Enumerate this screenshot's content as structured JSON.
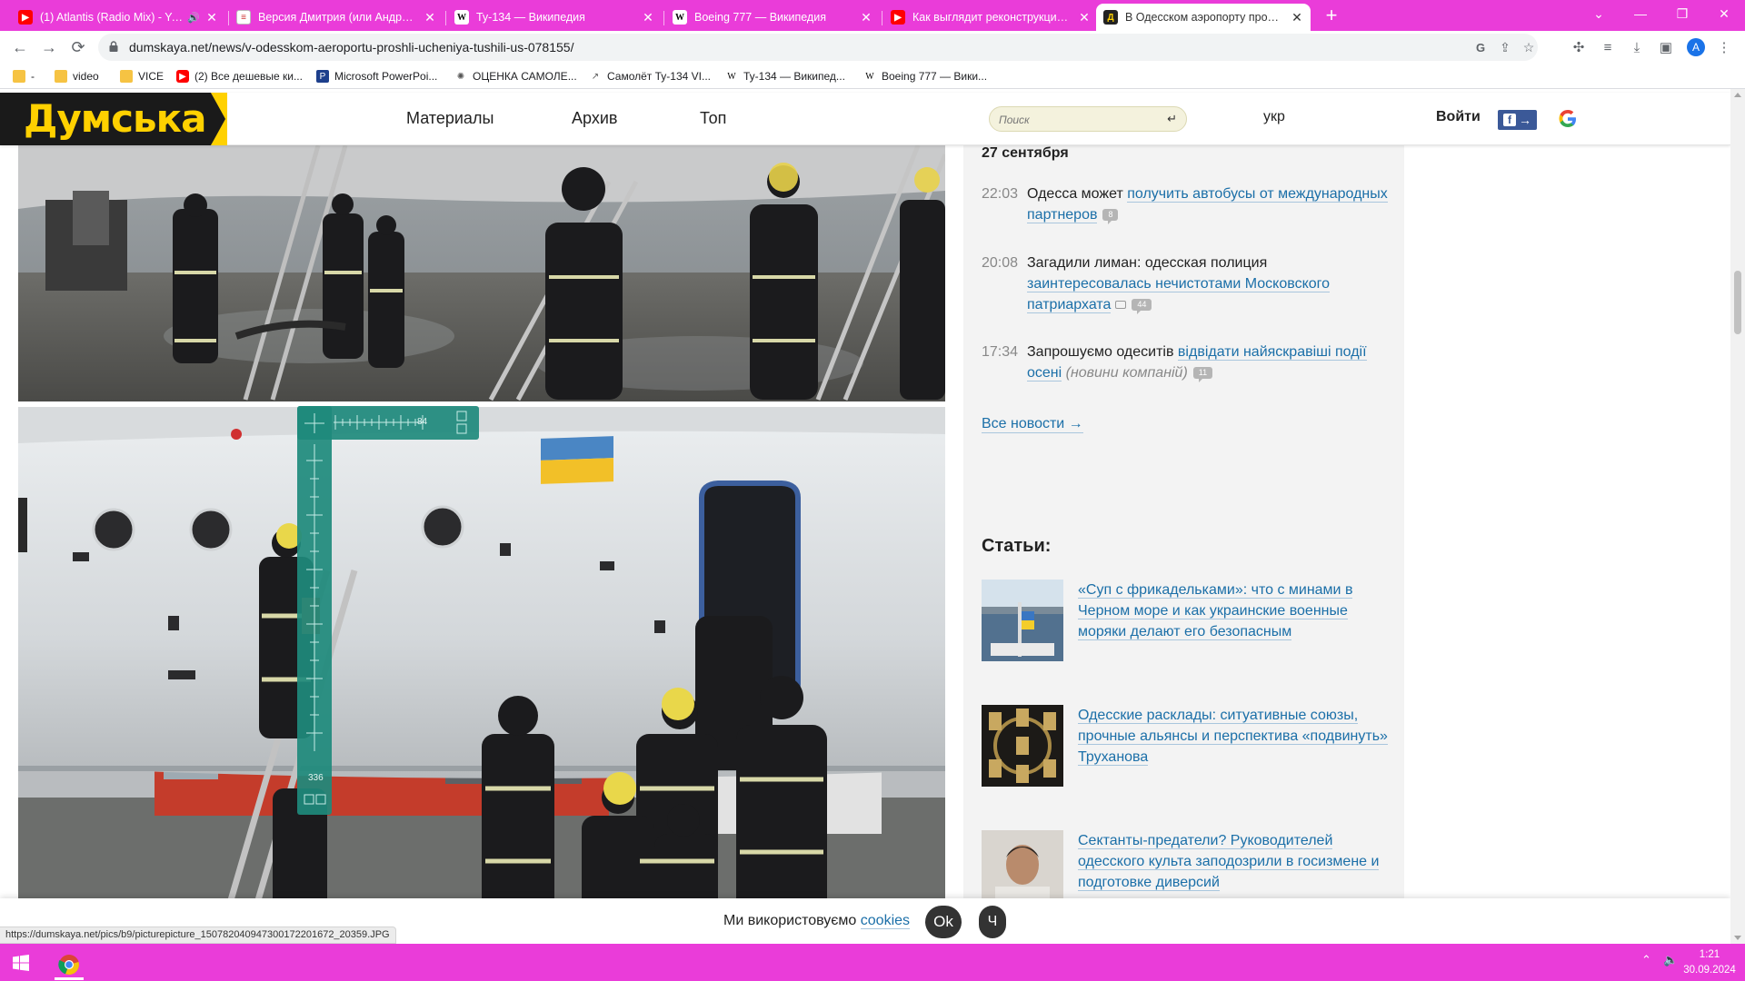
{
  "tabs": [
    {
      "title": "(1) Atlantis (Radio Mix) - YouTube",
      "icon": "youtube-icon",
      "audio": true
    },
    {
      "title": "Версия Дмитрия (или Андрея) Ф",
      "icon": "document-icon"
    },
    {
      "title": "Ту-134 — Википедия",
      "icon": "wikipedia-icon"
    },
    {
      "title": "Boeing 777 — Википедия",
      "icon": "wikipedia-icon"
    },
    {
      "title": "Как выглядит реконструкция сб",
      "icon": "youtube-icon"
    },
    {
      "title": "В Одесском аэропорту прошли",
      "icon": "dumskaya-icon",
      "active": true
    }
  ],
  "address": {
    "url": "dumskaya.net/news/v-odesskom-aeroportu-proshli-ucheniya-tushili-us-078155/"
  },
  "profile_initial": "A",
  "bookmarks": [
    {
      "label": "-",
      "icon": "folder-icon"
    },
    {
      "label": "video",
      "icon": "folder-icon"
    },
    {
      "label": "VICE",
      "icon": "folder-icon"
    },
    {
      "label": "(2) Все дешевые ки...",
      "icon": "youtube-icon"
    },
    {
      "label": "Microsoft PowerPoi...",
      "icon": "powerpoint-icon"
    },
    {
      "label": "ОЦЕНКА САМОЛЕ...",
      "icon": "site-icon"
    },
    {
      "label": "Самолёт Ту-134 VI...",
      "icon": "site-icon"
    },
    {
      "label": "Ту-134 — Википед...",
      "icon": "wikipedia-icon"
    },
    {
      "label": "Boeing 777 — Вики...",
      "icon": "wikipedia-icon"
    }
  ],
  "site": {
    "logo": "Думська",
    "menu": [
      "Материалы",
      "Архив",
      "Топ"
    ],
    "search_placeholder": "Поиск",
    "lang": "укр",
    "login": "Войти",
    "fb_arrow": "→"
  },
  "sidebar": {
    "date_heading": "27 сентября",
    "news": [
      {
        "time": "22:03",
        "prefix": "Одесса может ",
        "link": "получить автобусы от международных партнеров",
        "suffix": "",
        "comments": "8"
      },
      {
        "time": "20:08",
        "prefix": "Загадили лиман: одесская полиция ",
        "link": "заинтересовалась нечистотами Московского патриархата",
        "suffix": "",
        "comments": "44",
        "photo": true
      },
      {
        "time": "17:34",
        "prefix": "Запрошуємо одеситів ",
        "link": "відвідати найяскравіші події осені",
        "suffix": "(новини компаній)",
        "comments": "11"
      }
    ],
    "all_news": "Все новости →",
    "articles_heading": "Статьи:",
    "articles": [
      {
        "title": "«Суп с фрикадельками»: что с минами в Черном море и как украинские военные моряки делают его безопасным"
      },
      {
        "title": "Одесские расклады: ситуативные союзы, прочные альянсы и перспектива «подвинуть» Труханова"
      },
      {
        "title": "Сектанты-предатели? Руководителей одесского культа заподозрили в госизмене и подготовке диверсий"
      }
    ]
  },
  "ruler": {
    "top_value": "84",
    "side_value": "336"
  },
  "cookie": {
    "text": "Ми використовуємо ",
    "link": "cookies",
    "ok": "Ok",
    "second": "Ч"
  },
  "status_url": "https://dumskaya.net/pics/b9/picturepicture_150782040947300172201672_20359.JPG",
  "clock": {
    "time": "1:21",
    "date": "30.09.2024"
  },
  "colors": {
    "accent": "#ea3cd9",
    "link": "#1b6fa8",
    "logo": "#ffd100"
  }
}
